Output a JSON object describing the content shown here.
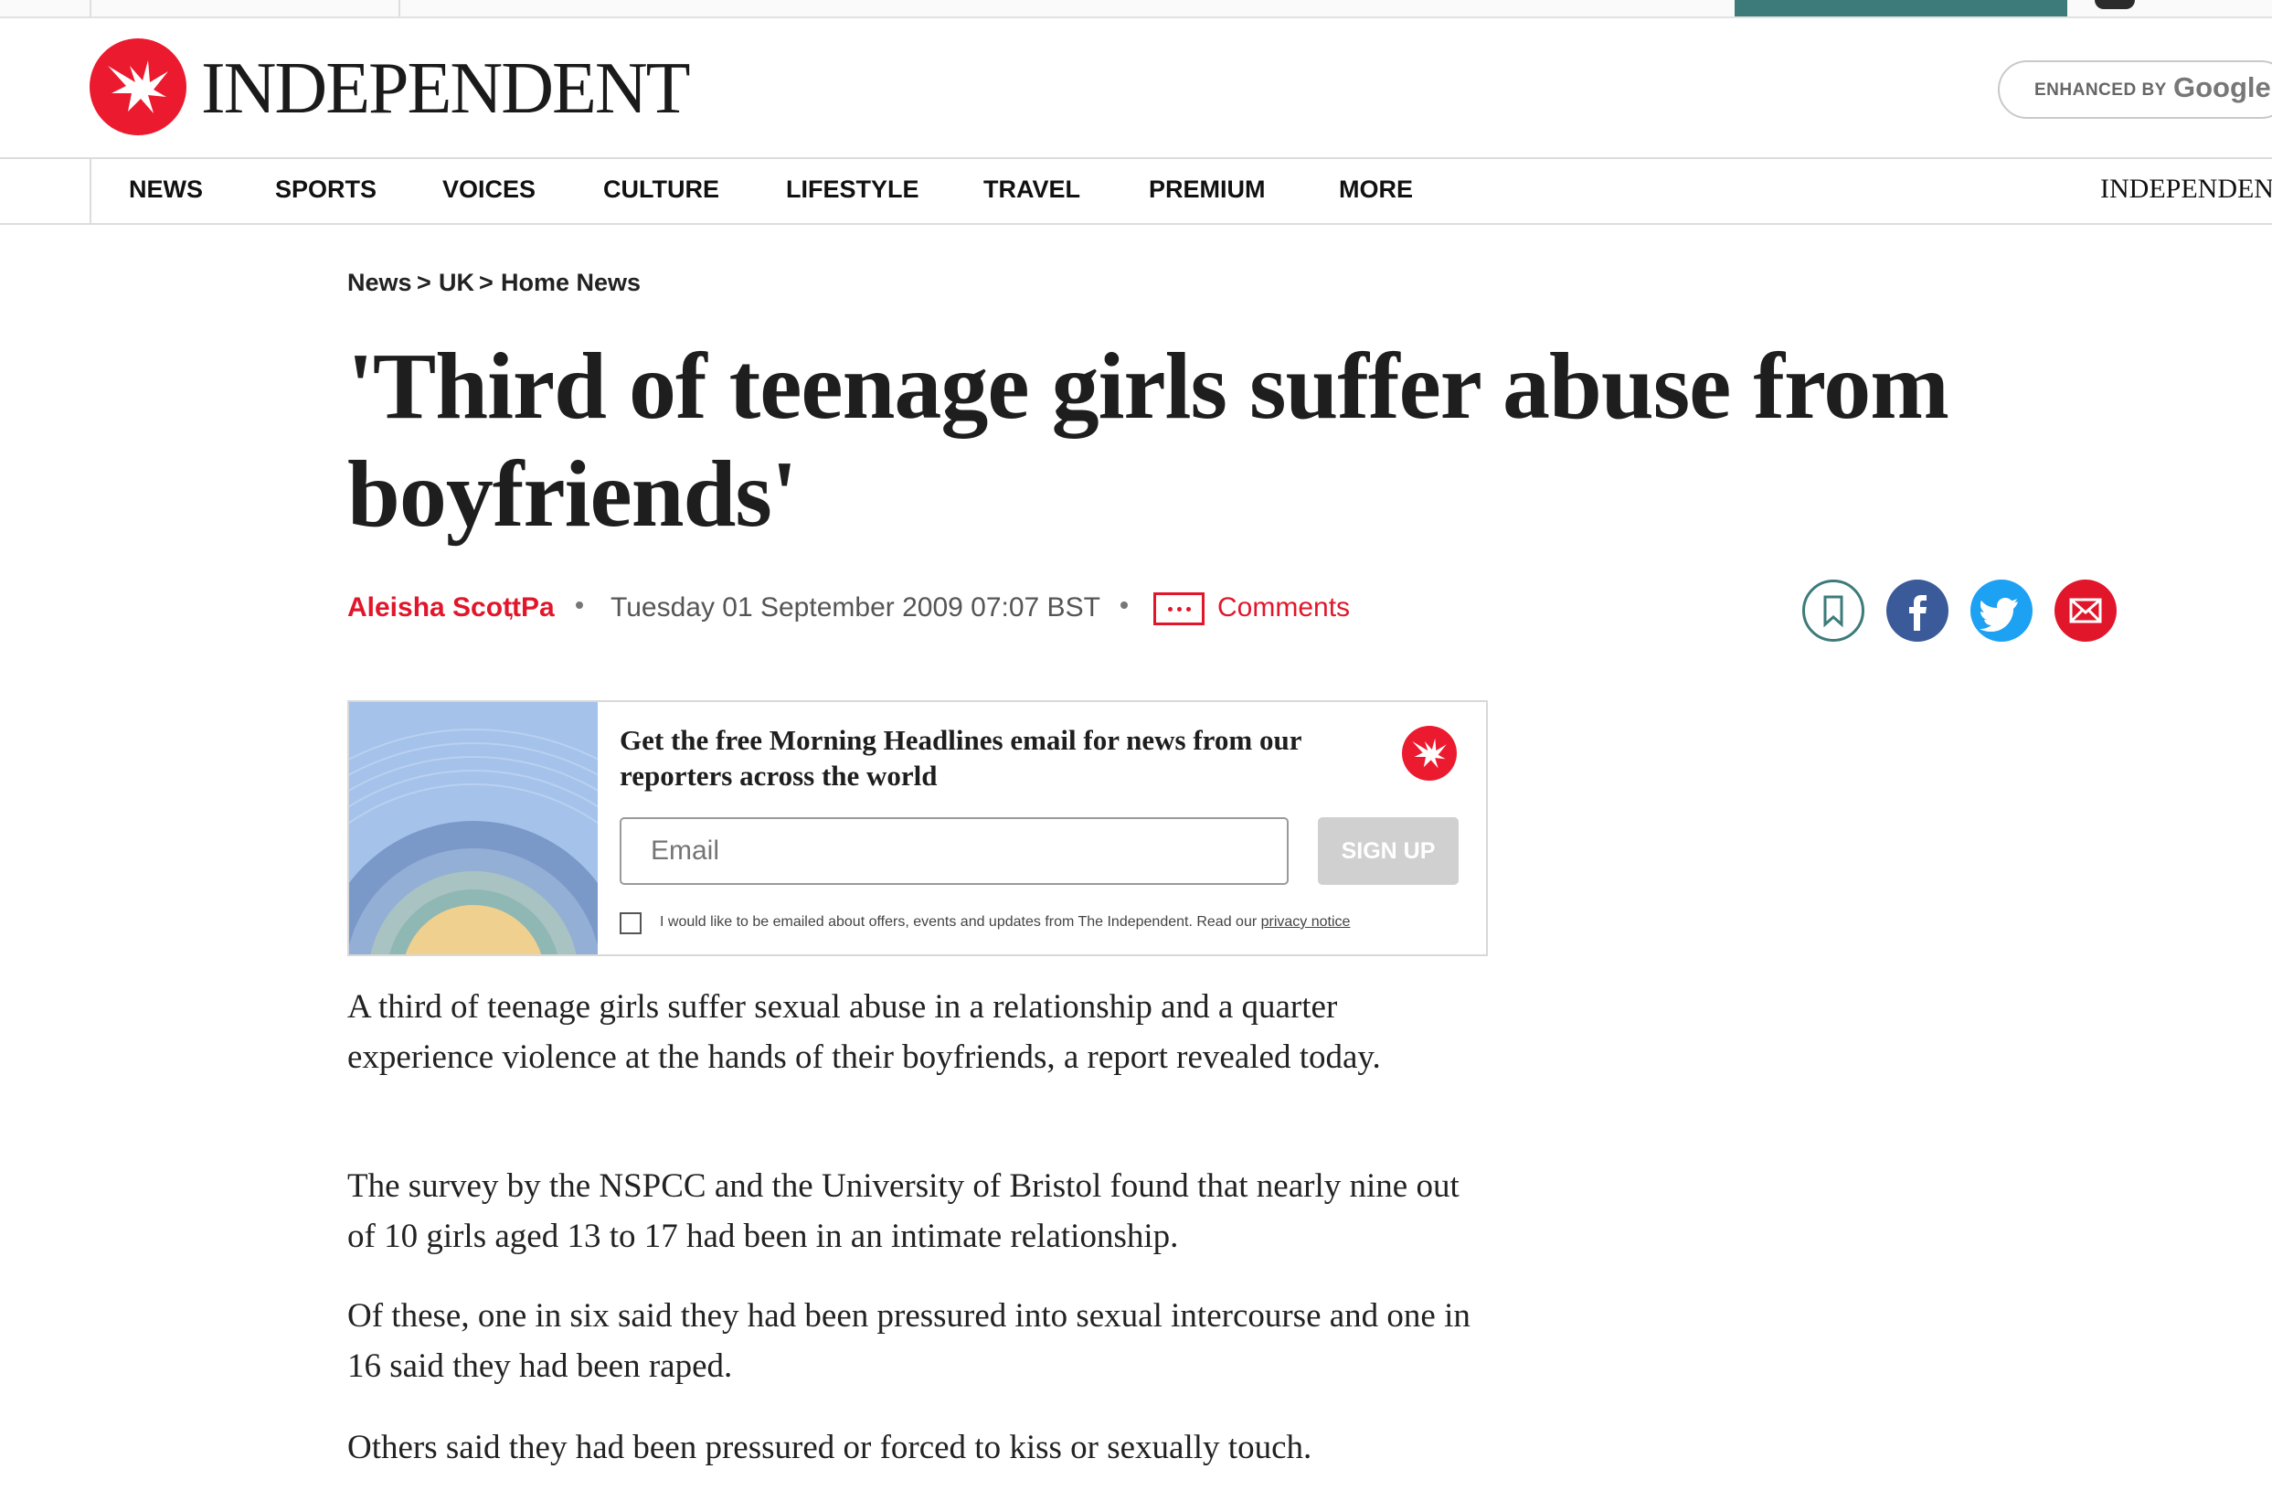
{
  "masthead": {
    "brand": "INDEPENDENT",
    "search_prefix": "ENHANCED BY",
    "search_brand": "Google"
  },
  "nav": {
    "items": [
      "NEWS",
      "SPORTS",
      "VOICES",
      "CULTURE",
      "LIFESTYLE",
      "TRAVEL",
      "PREMIUM",
      "MORE"
    ],
    "right_brand": "INDEPENDENT"
  },
  "breadcrumb": [
    "News",
    "UK",
    "Home News"
  ],
  "breadcrumb_separator": ">",
  "article": {
    "headline": "'Third of teenage girls suffer abuse from boyfriends'",
    "author": "Aleisha Scott",
    "agency": "Pa",
    "date": "Tuesday 01 September 2009 07:07 BST",
    "comments_label": "Comments",
    "paragraphs": [
      "A third of teenage girls suffer sexual abuse in a relationship and a quarter experience violence at the hands of their boyfriends, a report revealed today.",
      "The survey by the NSPCC and the University of Bristol found that nearly nine out of 10 girls aged 13 to 17 had been in an intimate relationship.",
      "Of these, one in six said they had been pressured into sexual intercourse and one in 16 said they had been raped.",
      "Others said they had been pressured or forced to kiss or sexually touch."
    ]
  },
  "newsletter": {
    "title": "Get the free Morning Headlines email for news from our reporters across the world",
    "email_placeholder": "Email",
    "signup_label": "SIGN UP",
    "consent_text": "I would like to be emailed about offers, events and updates from The Independent. Read our",
    "privacy_link": "privacy notice"
  },
  "colors": {
    "brand_red": "#ec1a2e",
    "teal": "#3d7b7a",
    "facebook": "#3b5a99",
    "twitter": "#1da1f2"
  },
  "icons": {
    "logo": "eagle-icon",
    "comments": "speech-bubble-icon",
    "bookmark": "bookmark-icon",
    "facebook": "facebook-icon",
    "twitter": "twitter-icon",
    "email": "envelope-icon"
  }
}
